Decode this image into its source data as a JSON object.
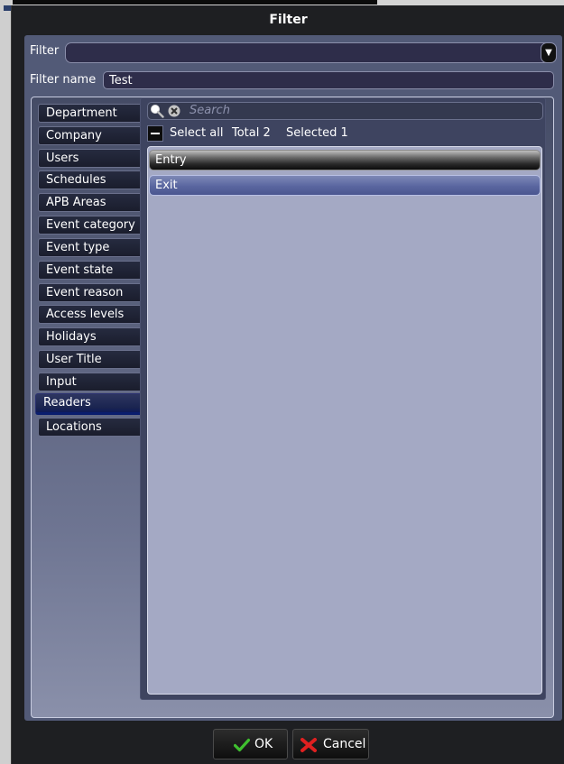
{
  "window": {
    "title": "Filter"
  },
  "form": {
    "filter_label": "Filter",
    "filter_value": "",
    "filter_name_label": "Filter name",
    "filter_name_value": "Test"
  },
  "tabs": [
    {
      "label": "Department",
      "active": false
    },
    {
      "label": "Company",
      "active": false
    },
    {
      "label": "Users",
      "active": false
    },
    {
      "label": "Schedules",
      "active": false
    },
    {
      "label": "APB Areas",
      "active": false
    },
    {
      "label": "Event category",
      "active": false
    },
    {
      "label": "Event type",
      "active": false
    },
    {
      "label": "Event state",
      "active": false
    },
    {
      "label": "Event reason",
      "active": false
    },
    {
      "label": "Access levels",
      "active": false
    },
    {
      "label": "Holidays",
      "active": false
    },
    {
      "label": "User Title",
      "active": false
    },
    {
      "label": "Input",
      "active": false
    },
    {
      "label": "Readers",
      "active": true
    },
    {
      "label": "Locations",
      "active": false
    }
  ],
  "search": {
    "placeholder": "Search"
  },
  "selection": {
    "select_all_label": "Select all",
    "total_text": "Total 2",
    "selected_text": "Selected 1"
  },
  "list": {
    "items": [
      {
        "label": "Entry",
        "selected": false
      },
      {
        "label": "Exit",
        "selected": true
      }
    ]
  },
  "buttons": {
    "ok_label": "OK",
    "cancel_label": "Cancel"
  },
  "icons": {
    "search": "search-icon",
    "clear": "clear-search-icon",
    "dropdown": "chevron-down-icon",
    "ok": "checkmark-icon",
    "cancel": "x-icon"
  },
  "colors": {
    "dialog_bg": "#1e1f22",
    "panel_bg": "#525a77",
    "list_bg": "#a4a9c4",
    "selected_item": "#5a66a0",
    "ok_icon": "#3fbf2f",
    "cancel_icon": "#e02020"
  }
}
